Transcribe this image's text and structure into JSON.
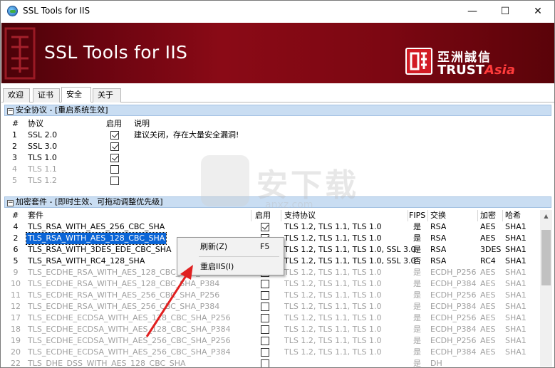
{
  "window": {
    "title": "SSL Tools for IIS",
    "minimize_glyph": "—",
    "maximize_glyph": "☐",
    "close_glyph": "✕"
  },
  "banner": {
    "title": "SSL Tools for IIS",
    "logo_cn": "亞洲誠信",
    "logo_en_trust": "TRUST",
    "logo_en_asia": "Asia"
  },
  "tabs": [
    {
      "label": "欢迎"
    },
    {
      "label": "证书"
    },
    {
      "label": "安全",
      "active": true
    },
    {
      "label": "关于"
    }
  ],
  "protocols": {
    "header": "安全协议 - [重启系统生效]",
    "columns": {
      "num": "#",
      "name": "协议",
      "enabled": "启用",
      "desc": "说明"
    },
    "rows": [
      {
        "num": "1",
        "name": "SSL 2.0",
        "enabled": true,
        "desc": "建议关闭，存在大量安全漏洞!",
        "active": true
      },
      {
        "num": "2",
        "name": "SSL 3.0",
        "enabled": true,
        "desc": "",
        "active": true
      },
      {
        "num": "3",
        "name": "TLS 1.0",
        "enabled": true,
        "desc": "",
        "active": true
      },
      {
        "num": "4",
        "name": "TLS 1.1",
        "enabled": false,
        "desc": "",
        "active": false
      },
      {
        "num": "5",
        "name": "TLS 1.2",
        "enabled": false,
        "desc": "",
        "active": false
      }
    ]
  },
  "ciphers": {
    "header": "加密套件 - [即时生效、可拖动调整优先级]",
    "columns": {
      "num": "#",
      "suite": "套件",
      "enabled": "启用",
      "protocols": "支持协议",
      "fips": "FIPS",
      "kx": "交换",
      "enc": "加密",
      "hash": "哈希"
    },
    "rows": [
      {
        "num": "4",
        "suite": "TLS_RSA_WITH_AES_256_CBC_SHA",
        "enabled": true,
        "protocols": "TLS 1.2, TLS 1.1, TLS 1.0",
        "fips": "是",
        "kx": "RSA",
        "enc": "AES",
        "hash": "SHA1",
        "active": true
      },
      {
        "num": "2",
        "suite": "TLS_RSA_WITH_AES_128_CBC_SHA",
        "enabled": true,
        "protocols": "TLS 1.2, TLS 1.1, TLS 1.0",
        "fips": "是",
        "kx": "RSA",
        "enc": "AES",
        "hash": "SHA1",
        "active": true,
        "selected": true
      },
      {
        "num": "6",
        "suite": "TLS_RSA_WITH_3DES_EDE_CBC_SHA",
        "enabled": true,
        "protocols": "TLS 1.2, TLS 1.1, TLS 1.0, SSL 3.0",
        "fips": "是",
        "kx": "RSA",
        "enc": "3DES",
        "hash": "SHA1",
        "active": true
      },
      {
        "num": "5",
        "suite": "TLS_RSA_WITH_RC4_128_SHA",
        "enabled": true,
        "protocols": "TLS 1.2, TLS 1.1, TLS 1.0, SSL 3.0",
        "fips": "否",
        "kx": "RSA",
        "enc": "RC4",
        "hash": "SHA1",
        "active": true
      },
      {
        "num": "9",
        "suite": "TLS_ECDHE_RSA_WITH_AES_128_CBC_SHA_P256",
        "enabled": false,
        "protocols": "TLS 1.2, TLS 1.1, TLS 1.0",
        "fips": "是",
        "kx": "ECDH_P256",
        "enc": "AES",
        "hash": "SHA1",
        "active": false
      },
      {
        "num": "10",
        "suite": "TLS_ECDHE_RSA_WITH_AES_128_CBC_SHA_P384",
        "enabled": false,
        "protocols": "TLS 1.2, TLS 1.1, TLS 1.0",
        "fips": "是",
        "kx": "ECDH_P384",
        "enc": "AES",
        "hash": "SHA1",
        "active": false
      },
      {
        "num": "11",
        "suite": "TLS_ECDHE_RSA_WITH_AES_256_CBC_SHA_P256",
        "enabled": false,
        "protocols": "TLS 1.2, TLS 1.1, TLS 1.0",
        "fips": "是",
        "kx": "ECDH_P256",
        "enc": "AES",
        "hash": "SHA1",
        "active": false
      },
      {
        "num": "12",
        "suite": "TLS_ECDHE_RSA_WITH_AES_256_CBC_SHA_P384",
        "enabled": false,
        "protocols": "TLS 1.2, TLS 1.1, TLS 1.0",
        "fips": "是",
        "kx": "ECDH_P384",
        "enc": "AES",
        "hash": "SHA1",
        "active": false
      },
      {
        "num": "17",
        "suite": "TLS_ECDHE_ECDSA_WITH_AES_128_CBC_SHA_P256",
        "enabled": false,
        "protocols": "TLS 1.2, TLS 1.1, TLS 1.0",
        "fips": "是",
        "kx": "ECDH_P256",
        "enc": "AES",
        "hash": "SHA1",
        "active": false
      },
      {
        "num": "18",
        "suite": "TLS_ECDHE_ECDSA_WITH_AES_128_CBC_SHA_P384",
        "enabled": false,
        "protocols": "TLS 1.2, TLS 1.1, TLS 1.0",
        "fips": "是",
        "kx": "ECDH_P384",
        "enc": "AES",
        "hash": "SHA1",
        "active": false
      },
      {
        "num": "19",
        "suite": "TLS_ECDHE_ECDSA_WITH_AES_256_CBC_SHA_P256",
        "enabled": false,
        "protocols": "TLS 1.2, TLS 1.1, TLS 1.0",
        "fips": "是",
        "kx": "ECDH_P256",
        "enc": "AES",
        "hash": "SHA1",
        "active": false
      },
      {
        "num": "20",
        "suite": "TLS_ECDHE_ECDSA_WITH_AES_256_CBC_SHA_P384",
        "enabled": false,
        "protocols": "TLS 1.2, TLS 1.1, TLS 1.0",
        "fips": "是",
        "kx": "ECDH_P384",
        "enc": "AES",
        "hash": "SHA1",
        "active": false
      },
      {
        "num": "22",
        "suite": "TLS_DHE_DSS_WITH_AES_128_CBC_SHA",
        "enabled": false,
        "protocols": "",
        "fips": "是",
        "kx": "DH",
        "enc": "",
        "hash": "",
        "active": false
      }
    ]
  },
  "context_menu": {
    "items": [
      {
        "label": "刷新(Z)",
        "shortcut": "F5"
      },
      {
        "label": "重启IIS(I)",
        "shortcut": ""
      }
    ]
  },
  "watermark": {
    "text": "安下载",
    "url": "anxz.com"
  },
  "colors": {
    "banner_red": "#7c0712",
    "group_header": "#c9ddf2",
    "selection": "#0a64d6",
    "arrow": "#e02020"
  }
}
